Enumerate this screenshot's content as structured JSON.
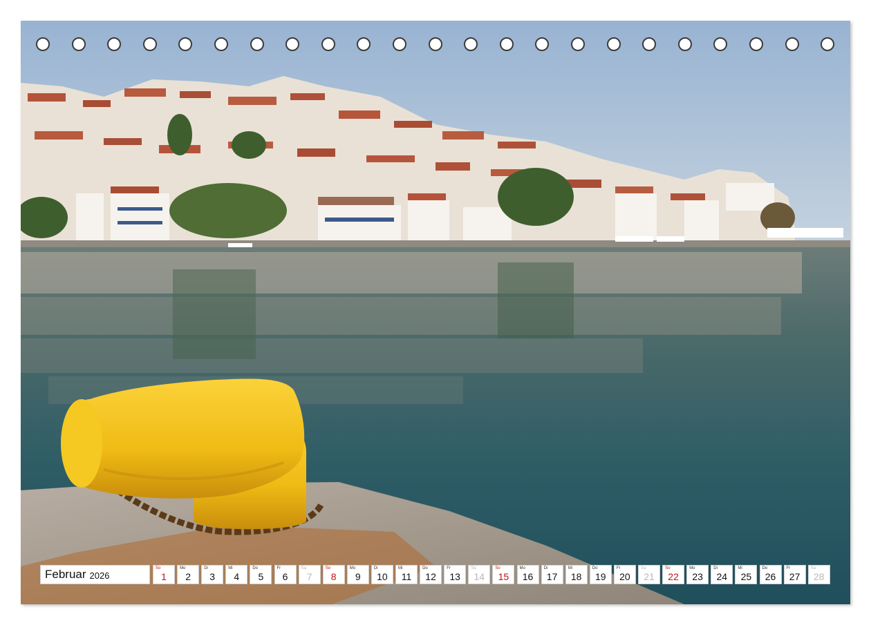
{
  "colors": {
    "sky": "#9fb8d4",
    "water": "#2e5f66",
    "bollard": "#f2c21a",
    "quay": "#a69a8c",
    "sunday": "#c0111b",
    "saturday": "#b8b8b8"
  },
  "calendar": {
    "month": "Februar",
    "year": "2026",
    "days": [
      {
        "wd": "So",
        "num": "1",
        "type": "sun"
      },
      {
        "wd": "Mo",
        "num": "2",
        "type": "week"
      },
      {
        "wd": "Di",
        "num": "3",
        "type": "week"
      },
      {
        "wd": "Mi",
        "num": "4",
        "type": "week"
      },
      {
        "wd": "Do",
        "num": "5",
        "type": "week"
      },
      {
        "wd": "Fr",
        "num": "6",
        "type": "week"
      },
      {
        "wd": "Sa",
        "num": "7",
        "type": "sat"
      },
      {
        "wd": "So",
        "num": "8",
        "type": "sun"
      },
      {
        "wd": "Mo",
        "num": "9",
        "type": "week"
      },
      {
        "wd": "Di",
        "num": "10",
        "type": "week"
      },
      {
        "wd": "Mi",
        "num": "11",
        "type": "week"
      },
      {
        "wd": "Do",
        "num": "12",
        "type": "week"
      },
      {
        "wd": "Fr",
        "num": "13",
        "type": "week"
      },
      {
        "wd": "Sa",
        "num": "14",
        "type": "sat"
      },
      {
        "wd": "So",
        "num": "15",
        "type": "sun"
      },
      {
        "wd": "Mo",
        "num": "16",
        "type": "week"
      },
      {
        "wd": "Di",
        "num": "17",
        "type": "week"
      },
      {
        "wd": "Mi",
        "num": "18",
        "type": "week"
      },
      {
        "wd": "Do",
        "num": "19",
        "type": "week"
      },
      {
        "wd": "Fr",
        "num": "20",
        "type": "week"
      },
      {
        "wd": "Sa",
        "num": "21",
        "type": "sat"
      },
      {
        "wd": "So",
        "num": "22",
        "type": "sun"
      },
      {
        "wd": "Mo",
        "num": "23",
        "type": "week"
      },
      {
        "wd": "Di",
        "num": "24",
        "type": "week"
      },
      {
        "wd": "Mi",
        "num": "25",
        "type": "week"
      },
      {
        "wd": "Do",
        "num": "26",
        "type": "week"
      },
      {
        "wd": "Fr",
        "num": "27",
        "type": "week"
      },
      {
        "wd": "Sa",
        "num": "28",
        "type": "sat"
      }
    ]
  }
}
